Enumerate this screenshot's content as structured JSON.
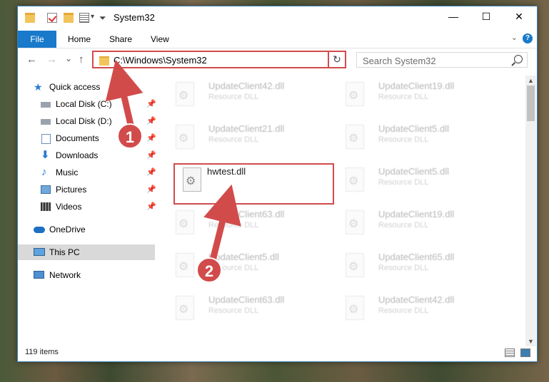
{
  "window": {
    "title": "System32"
  },
  "window_controls": {
    "minimize": "—",
    "maximize": "☐",
    "close": "✕"
  },
  "ribbon": {
    "file": "File",
    "tabs": [
      "Home",
      "Share",
      "View"
    ],
    "help": "?"
  },
  "nav": {
    "back": "←",
    "forward": "→",
    "recent": "⌄",
    "up": "↑"
  },
  "address": {
    "path": "C:\\Windows\\System32"
  },
  "search": {
    "placeholder": "Search System32"
  },
  "sidebar": {
    "items": [
      {
        "label": "Quick access",
        "pinned": false
      },
      {
        "label": "Local Disk (C:)",
        "pinned": true
      },
      {
        "label": "Local Disk (D:)",
        "pinned": true
      },
      {
        "label": "Documents",
        "pinned": true
      },
      {
        "label": "Downloads",
        "pinned": true
      },
      {
        "label": "Music",
        "pinned": true
      },
      {
        "label": "Pictures",
        "pinned": true
      },
      {
        "label": "Videos",
        "pinned": true
      },
      {
        "label": "OneDrive",
        "pinned": false
      },
      {
        "label": "This PC",
        "pinned": false
      },
      {
        "label": "Network",
        "pinned": false
      }
    ]
  },
  "files": [
    {
      "name": "UpdateClient42.dll",
      "type": "Resource DLL"
    },
    {
      "name": "UpdateClient19.dll",
      "type": "Resource DLL"
    },
    {
      "name": "UpdateClient21.dll",
      "type": "Resource DLL"
    },
    {
      "name": "UpdateClient5.dll",
      "type": "Resource DLL"
    },
    {
      "name": "hwtest.dll",
      "type": ""
    },
    {
      "name": "UpdateClient5.dll",
      "type": "Resource DLL"
    },
    {
      "name": "UpdateClient63.dll",
      "type": "Resource DLL"
    },
    {
      "name": "UpdateClient19.dll",
      "type": "Resource DLL"
    },
    {
      "name": "UpdateClient5.dll",
      "type": "Resource DLL"
    },
    {
      "name": "UpdateClient65.dll",
      "type": "Resource DLL"
    },
    {
      "name": "UpdateClient63.dll",
      "type": "Resource DLL"
    },
    {
      "name": "UpdateClient42.dll",
      "type": "Resource DLL"
    }
  ],
  "status": {
    "item_count": "119 items"
  },
  "annotations": {
    "step1": "1",
    "step2": "2",
    "color": "#d24b4b"
  }
}
